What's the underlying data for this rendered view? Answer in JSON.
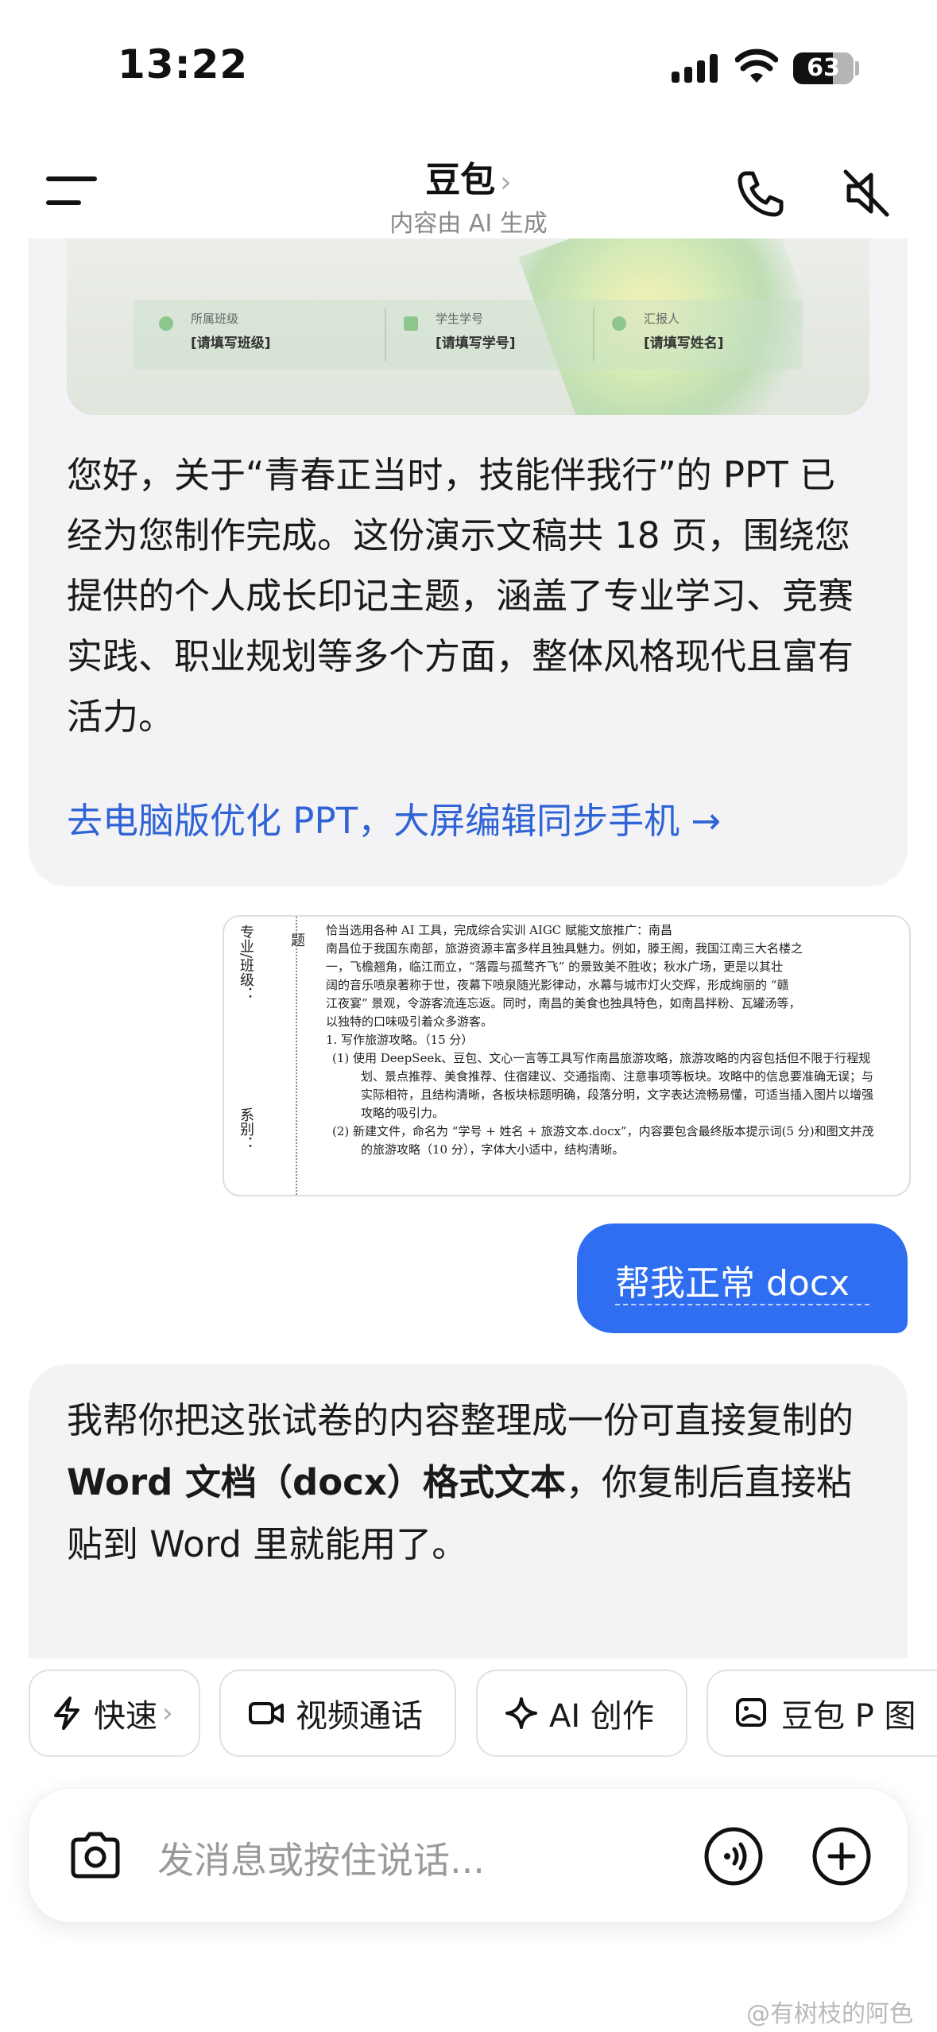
{
  "status_bar": {
    "time": "13:22",
    "battery": "63"
  },
  "header": {
    "title": "豆包",
    "subtitle": "内容由 AI 生成",
    "title_chevron": "›"
  },
  "ppt_preview": {
    "fields": [
      {
        "label": "所属班级",
        "value": "[请填写班级]"
      },
      {
        "label": "学生学号",
        "value": "[请填写学号]"
      },
      {
        "label": "汇报人",
        "value": "[请填写姓名]"
      }
    ]
  },
  "messages": {
    "ai_1": "您好，关于“青春正当时，技能伴我行”的 PPT 已经为您制作完成。这份演示文稿共 18 页，围绕您提供的个人成长印记主题，涵盖了专业学习、竞赛实践、职业规划等多个方面，整体风格现代且富有活力。",
    "ppt_link": "去电脑版优化 PPT，大屏编辑同步手机 →",
    "user": "帮我正常 docx",
    "ai_2_a": "我帮你把这张试卷的内容整理成一份可直接复制的 ",
    "ai_2_bold": "Word 文档（docx）格式文本",
    "ai_2_b": "，你复制后直接粘贴到 Word 里就能用了。"
  },
  "exam_image": {
    "side_major": "专业/班级：",
    "side_dept": "系别：",
    "side_topic": "题",
    "lines": [
      "恰当选用各种 AI 工具，完成综合实训 AIGC 赋能文旅推广：南昌",
      "南昌位于我国东南部，旅游资源丰富多样且独具魅力。例如，滕王阁，我国江南三大名楼之",
      "一，飞檐翘角，临江而立，“落霞与孤鹜齐飞” 的景致美不胜收；秋水广场，更是以其壮",
      "阔的音乐喷泉著称于世，夜幕下喷泉随光影律动，水幕与城市灯火交辉，形成绚丽的 “赣",
      "江夜宴” 景观，令游客流连忘返。同时，南昌的美食也独具特色，如南昌拌粉、瓦罐汤等，",
      "以独特的口味吸引着众多游客。",
      "1. 写作旅游攻略。（15 分）"
    ],
    "items": [
      "(1)   使用 DeepSeek、豆包、文心一言等工具写作南昌旅游攻略，旅游攻略的内容包括但不限于行程规划、景点推荐、美食推荐、住宿建议、交通指南、注意事项等板块。攻略中的信息要准确无误；与实际相符，且结构清晰，各板块标题明确，段落分明，文字表达流畅易懂，可适当插入图片以增强攻略的吸引力。",
      "(2)   新建文件，命名为 “学号 + 姓名 + 旅游文本.docx”，内容要包含最终版本提示词(5 分)和图文并茂的旅游攻略（10 分），字体大小适中，结构清晰。"
    ]
  },
  "chips": [
    {
      "label": "快速",
      "chevron": "›",
      "icon": "lightning-icon"
    },
    {
      "label": "视频通话",
      "icon": "video-icon"
    },
    {
      "label": "AI 创作",
      "icon": "sparkle-icon"
    },
    {
      "label": "豆包 P 图",
      "icon": "image-edit-icon"
    }
  ],
  "input": {
    "placeholder": "发消息或按住说话..."
  },
  "watermark": "@有树枝的阿色",
  "colors": {
    "accent": "#2f6ef0",
    "link": "#2f63d6",
    "bubble": "#f3f3f5"
  }
}
